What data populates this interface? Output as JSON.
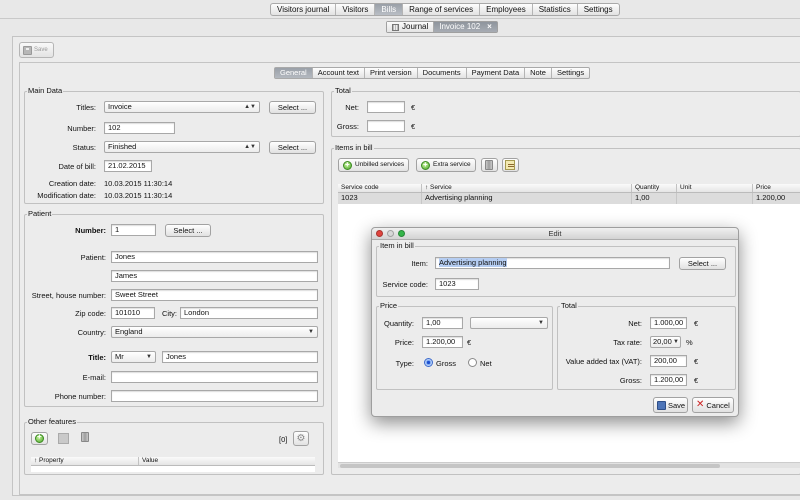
{
  "topnav": [
    "Visitors journal",
    "Visitors",
    "Bills",
    "Range of services",
    "Employees",
    "Statistics",
    "Settings"
  ],
  "topnav_active": "Bills",
  "doctabs": {
    "journal": "Journal",
    "invoice": "Invoice 102",
    "close": "×"
  },
  "toolbar": {
    "save_label": "Save"
  },
  "subtabs": [
    "General",
    "Account text",
    "Print version",
    "Documents",
    "Payment Data",
    "Note",
    "Settings"
  ],
  "main_data": {
    "title": "Main Data",
    "titles_label": "Titles:",
    "titles_value": "Invoice",
    "number_label": "Number:",
    "number_value": "102",
    "status_label": "Status:",
    "status_value": "Finished",
    "select_label": "Select ...",
    "date_of_bill_label": "Date of bill:",
    "date_of_bill_value": "21.02.2015",
    "creation_date_label": "Creation date:",
    "creation_date_value": "10.03.2015  11:30:14",
    "modification_date_label": "Modification date:",
    "modification_date_value": "10.03.2015  11:30:14"
  },
  "patient": {
    "title": "Patient",
    "number_label": "Number:",
    "number_value": "1",
    "select_label": "Select ...",
    "patient_label": "Patient:",
    "last_name": "Jones",
    "first_name": "James",
    "street_label": "Street, house number:",
    "street_value": "Sweet Street",
    "zip_label": "Zip code:",
    "zip_value": "101010",
    "city_label": "City:",
    "city_value": "London",
    "country_label": "Country:",
    "country_value": "England",
    "title_label": "Title:",
    "title_value": "Mr",
    "title_name": "Jones",
    "email_label": "E-mail:",
    "email_value": "",
    "phone_label": "Phone number:",
    "phone_value": ""
  },
  "other_features": {
    "title": "Other features",
    "count": "[0]",
    "columns": [
      "↑ Property",
      "Value"
    ]
  },
  "total": {
    "title": "Total",
    "net_label": "Net:",
    "net_value": "",
    "gross_label": "Gross:",
    "gross_value": "",
    "currency": "€"
  },
  "items_in_bill": {
    "title": "Items in bill",
    "unbilled_label": "Unbilled services",
    "extra_label": "Extra service",
    "columns": [
      "Service code",
      "↑ Service",
      "Quantity",
      "Unit",
      "Price"
    ],
    "rows": [
      [
        "1023",
        "Advertising planning",
        "1,00",
        "",
        "1.200,00"
      ]
    ]
  },
  "edit_dialog": {
    "title": "Edit",
    "item_in_bill_title": "Item in bill",
    "item_label": "Item:",
    "item_value": "Advertising planning",
    "select_label": "Select ...",
    "service_code_label": "Service code:",
    "service_code_value": "1023",
    "price_title": "Price",
    "quantity_label": "Quantity:",
    "quantity_value": "1,00",
    "unit_value": "",
    "price_label": "Price:",
    "price_value": "1.200,00",
    "currency": "€",
    "type_label": "Type:",
    "gross_option": "Gross",
    "net_option": "Net",
    "total_title": "Total",
    "net_label": "Net:",
    "net_value": "1.000,00",
    "tax_rate_label": "Tax rate:",
    "tax_rate_value": "20,00",
    "percent": "%",
    "vat_label": "Value added tax (VAT):",
    "vat_value": "200,00",
    "gross_label": "Gross:",
    "gross_value": "1.200,00",
    "save_label": "Save",
    "cancel_label": "Cancel"
  },
  "colors": {
    "active_tab": "#9aa0a8",
    "highlight": "#b5cdf2",
    "cancel_red": "#cc2222"
  }
}
